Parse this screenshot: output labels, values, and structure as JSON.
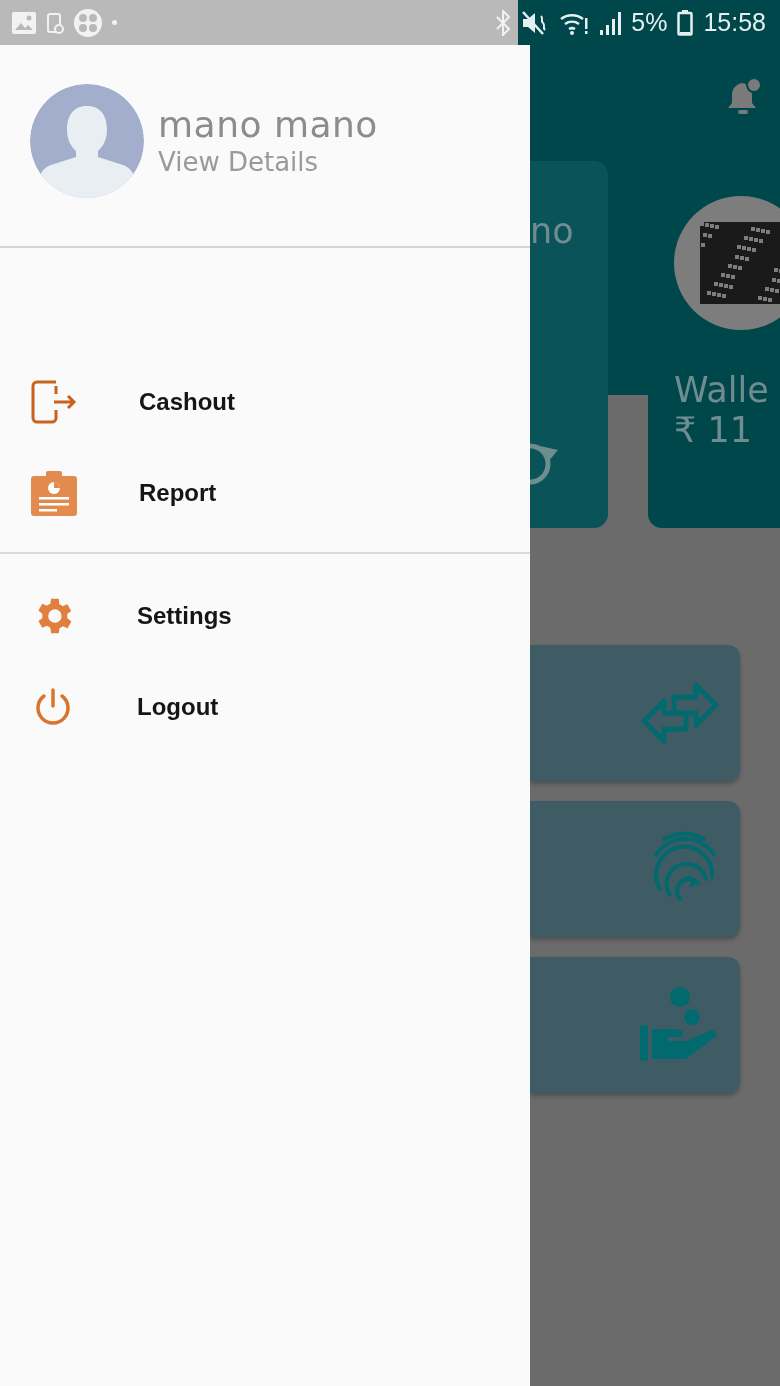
{
  "status_bar": {
    "battery": "5%",
    "time": "15:58"
  },
  "drawer": {
    "profile": {
      "name": "mano mano",
      "link": "View Details"
    },
    "sections": [
      [
        {
          "label": "Cashout"
        },
        {
          "label": "Report"
        }
      ],
      [
        {
          "label": "Settings"
        },
        {
          "label": "Logout"
        }
      ]
    ]
  },
  "background_app": {
    "cards": [
      {
        "text": "no"
      },
      {
        "title": "Walle",
        "amount": "₹ 11"
      }
    ]
  }
}
